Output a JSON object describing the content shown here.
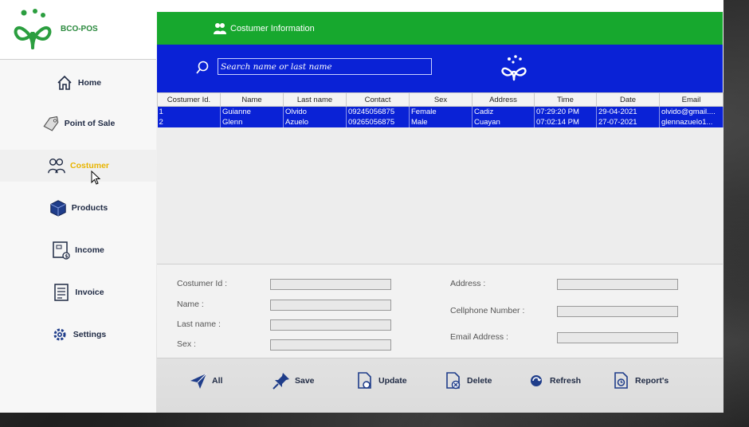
{
  "app": {
    "name": "BCO-POS"
  },
  "sidebar": {
    "items": [
      {
        "label": "Home",
        "icon": "home-icon",
        "active": false
      },
      {
        "label": "Point of Sale",
        "icon": "price-tag-icon",
        "active": false
      },
      {
        "label": "Costumer",
        "icon": "customers-icon",
        "active": true
      },
      {
        "label": "Products",
        "icon": "box-icon",
        "active": false
      },
      {
        "label": "Income",
        "icon": "money-document-icon",
        "active": false
      },
      {
        "label": "Invoice",
        "icon": "invoice-icon",
        "active": false
      },
      {
        "label": "Settings",
        "icon": "gear-icon",
        "active": false
      }
    ]
  },
  "header": {
    "title": "Costumer Information",
    "icon": "group-icon"
  },
  "search": {
    "placeholder": "Search name or last name"
  },
  "table": {
    "columns": [
      "Costumer Id.",
      "Name",
      "Last name",
      "Contact",
      "Sex",
      "Address",
      "Time",
      "Date",
      "Email"
    ],
    "rows": [
      [
        "1",
        "Guianne",
        "Olvido",
        "09245056875",
        "Female",
        "Cadiz",
        "07:29:20 PM",
        "29-04-2021",
        "olvido@gmail...."
      ],
      [
        "2",
        "Glenn",
        "Azuelo",
        "09265056875",
        "Male",
        "Cuayan",
        "07:02:14 PM",
        "27-07-2021",
        "glennazuelo1..."
      ]
    ]
  },
  "form": {
    "customer_id_label": "Costumer Id :",
    "name_label": "Name :",
    "last_name_label": "Last name :",
    "sex_label": "Sex :",
    "address_label": "Address :",
    "cellphone_label": "Cellphone Number :",
    "email_label": "Email Address :"
  },
  "actions": {
    "all": "All",
    "save": "Save",
    "update": "Update",
    "delete": "Delete",
    "refresh": "Refresh",
    "reports": "Report's"
  },
  "colors": {
    "green_header": "#17a82e",
    "blue_bar": "#0a22d6",
    "active_nav": "#e8b400",
    "nav_text": "#1f2a44"
  }
}
